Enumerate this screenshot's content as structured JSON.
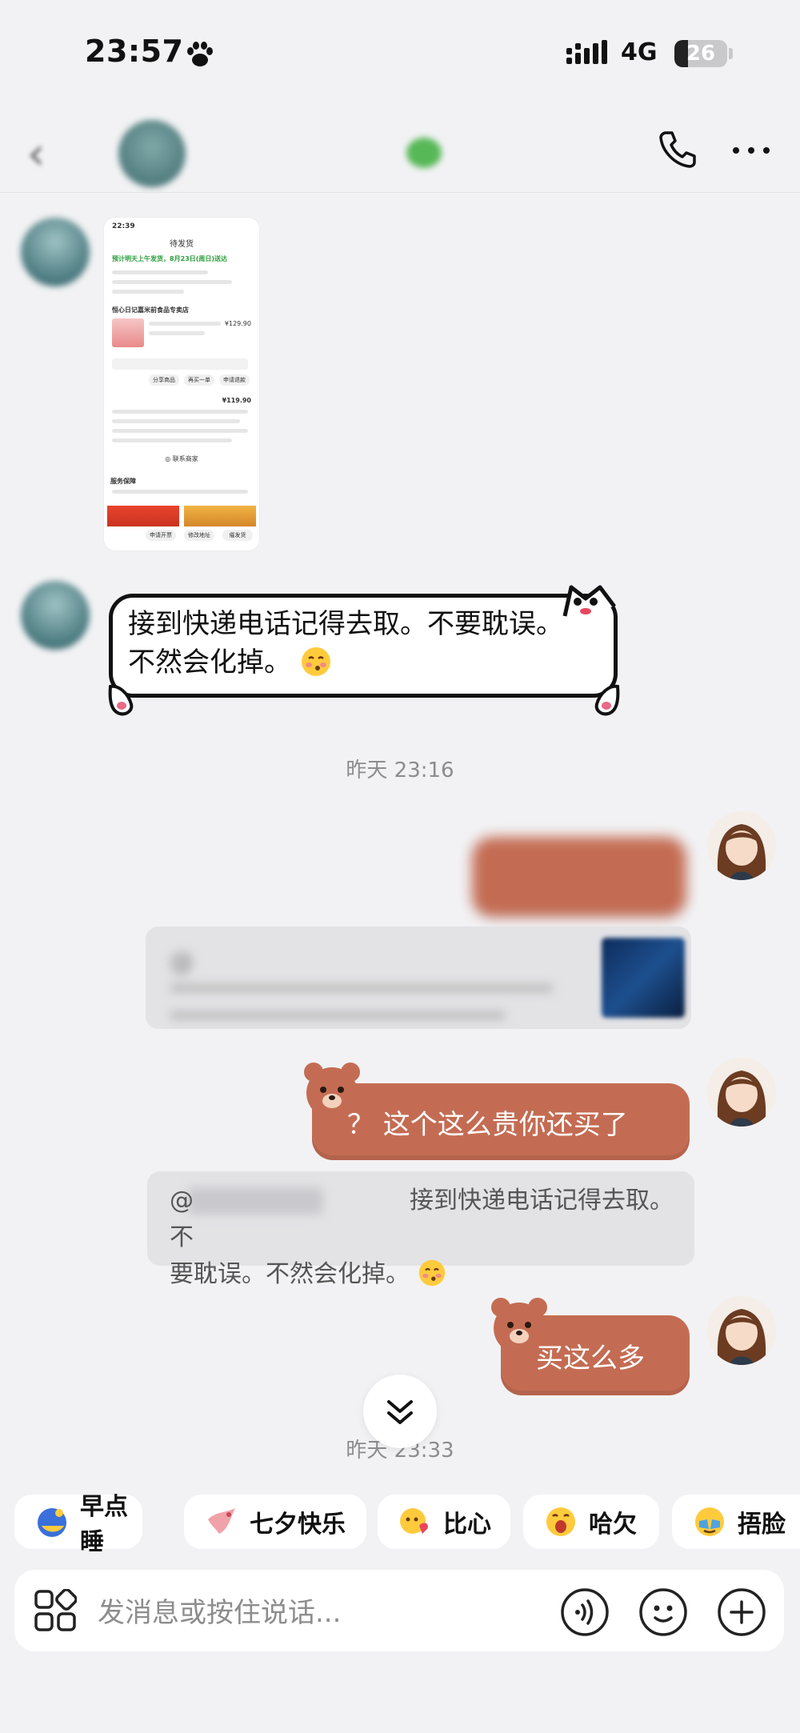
{
  "status_bar": {
    "time": "23:57",
    "network": "4G",
    "battery": "26",
    "battery_level": 0.26
  },
  "header": {
    "contact_name": "",
    "unread": ""
  },
  "messages": {
    "cat_text": "接到快递电话记得去取。不要耽误。不然会化掉。",
    "time_1": "昨天 23:16",
    "bubble_1": "",
    "bubble_2": "？ 这个这么贵你还买了",
    "quote_1_text": "@",
    "quote_2_line1": "@　　　　　　　　　接到快递电话记得去取。不",
    "quote_2_line2": "要耽误。不然会化掉。",
    "bubble_3": "买这么多",
    "time_2": "昨天 23:33"
  },
  "quick_replies": [
    "早点睡",
    "七夕快乐",
    "比心",
    "哈欠",
    "捂脸"
  ],
  "input": {
    "placeholder": "发消息或按住说话..."
  },
  "colors": {
    "bear_bubble": "#c46c53",
    "quote_bg": "#e3e3e6",
    "page_bg": "#f2f2f4"
  },
  "icons": [
    "paw-icon",
    "signal-icon",
    "back-icon",
    "phone-icon",
    "more-icon",
    "chevron-double-down-icon",
    "apps-icon",
    "voice-icon",
    "emoji-icon",
    "plus-icon"
  ]
}
